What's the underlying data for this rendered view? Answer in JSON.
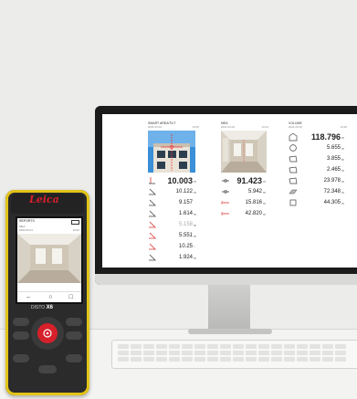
{
  "device": {
    "brand": "Leica",
    "model_prefix": "DISTO",
    "model": "X6",
    "screen": {
      "title": "REPORTS",
      "date": "2022.02.01",
      "sub_title": "MEA",
      "sub_time": "13:40",
      "nav": [
        "←",
        "○",
        "□"
      ]
    }
  },
  "monitor": {
    "columns": [
      {
        "header": "SMART AREA/TILT",
        "date": "2021.03.02",
        "time": "13:05",
        "rows": [
          {
            "icon": "height-icon",
            "value": "10.003",
            "unit": "m",
            "style": "big"
          },
          {
            "icon": "angle-icon",
            "value": "10.122",
            "unit": "m",
            "style": "normal"
          },
          {
            "icon": "angle-icon",
            "value": "9.157",
            "unit": "",
            "style": "normal"
          },
          {
            "icon": "angle-icon",
            "value": "1.614",
            "unit": "m",
            "style": "normal"
          },
          {
            "icon": "angle-red-icon",
            "value": "5.158",
            "unit": "m",
            "style": "faint"
          },
          {
            "icon": "angle-red-icon",
            "value": "5.551",
            "unit": "m",
            "style": "normal"
          },
          {
            "icon": "angle-red-icon",
            "value": "10.25",
            "unit": "°",
            "style": "normal"
          },
          {
            "icon": "angle-icon",
            "value": "1.924",
            "unit": "m",
            "style": "normal"
          }
        ]
      },
      {
        "header": "MEA",
        "date": "2021.03.02",
        "time": "13:12",
        "rows": [
          {
            "icon": "distance-icon",
            "value": "91.423",
            "unit": "m",
            "style": "big"
          },
          {
            "icon": "distance-icon",
            "value": "5.942",
            "unit": "m",
            "style": "normal"
          },
          {
            "icon": "line-red-icon",
            "value": "15.816",
            "unit": "m",
            "style": "normal"
          },
          {
            "icon": "line-red-icon",
            "value": "42.820",
            "unit": "m",
            "style": "normal"
          }
        ]
      },
      {
        "header": "VOLUME",
        "date": "2021.03.02",
        "time": "13:20",
        "rows": [
          {
            "icon": "room-icon",
            "value": "118.796",
            "unit": "m",
            "style": "big"
          },
          {
            "icon": "circle-icon",
            "value": "5.655",
            "unit": "m",
            "style": "normal"
          },
          {
            "icon": "shape-icon",
            "value": "3.855",
            "unit": "m",
            "style": "normal"
          },
          {
            "icon": "shape-icon",
            "value": "2.465",
            "unit": "m",
            "style": "normal"
          },
          {
            "icon": "shape-icon",
            "value": "23.978",
            "unit": "m",
            "style": "normal"
          },
          {
            "icon": "floor-icon",
            "value": "72.348",
            "unit": "m",
            "style": "normal"
          },
          {
            "icon": "wall-icon",
            "value": "44.305",
            "unit": "m",
            "style": "normal"
          }
        ]
      }
    ]
  },
  "colors": {
    "accent_red": "#d6202a",
    "device_yellow": "#e3c418",
    "sky": "#3b8fd6"
  }
}
